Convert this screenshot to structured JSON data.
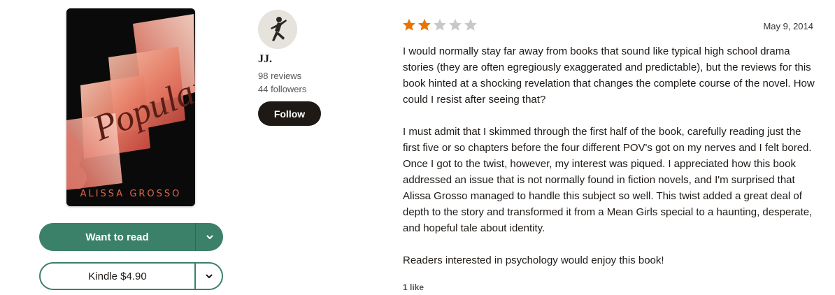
{
  "book": {
    "cover_title": "Popular",
    "cover_author": "ALISSA GROSSO"
  },
  "shelf": {
    "want_to_read_label": "Want to read",
    "kindle_label": "Kindle $4.90"
  },
  "reviewer": {
    "name": "JJ.",
    "reviews": "98 reviews",
    "followers": "44 followers",
    "follow_label": "Follow"
  },
  "review": {
    "rating": 2,
    "max_rating": 5,
    "date": "May 9, 2014",
    "paragraphs": [
      "I would normally stay far away from books that sound like typical high school drama stories (they are often egregiously exaggerated and predictable), but the reviews for this book hinted at a shocking revelation that changes the complete course of the novel. How could I resist after seeing that?",
      "I must admit that I skimmed through the first half of the book, carefully reading just the first five or so chapters before the four different POV's got on my nerves and I felt bored. Once I got to the twist, however, my interest was piqued. I appreciated how this book addressed an issue that is not normally found in fiction novels, and I'm surprised that Alissa Grosso managed to handle this subject so well. This twist added a great deal of depth to the story and transformed it from a Mean Girls special to a haunting, desperate, and hopeful tale about identity.",
      "Readers interested in psychology would enjoy this book!"
    ],
    "likes": "1 like"
  },
  "colors": {
    "accent_green": "#3b8068",
    "star_filled": "#e87400",
    "star_empty": "#c8c8c8",
    "follow_bg": "#1e1915"
  },
  "icons": {
    "dropdown": "chevron-down-icon",
    "star": "star-icon"
  }
}
